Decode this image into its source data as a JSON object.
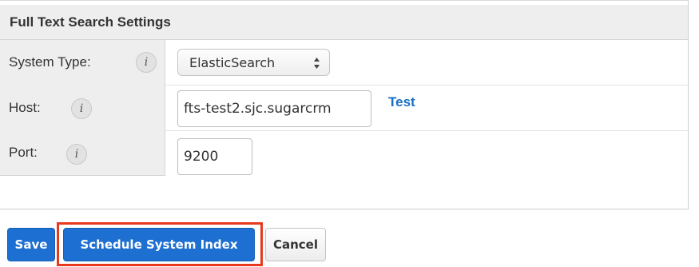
{
  "panel": {
    "title": "Full Text Search Settings"
  },
  "fields": {
    "system_type": {
      "label": "System Type:",
      "value": "ElasticSearch"
    },
    "host": {
      "label": "Host:",
      "value": "fts-test2.sjc.sugarcrm",
      "test_link": "Test"
    },
    "port": {
      "label": "Port:",
      "value": "9200"
    },
    "info_icon_glyph": "i"
  },
  "actions": {
    "save": "Save",
    "schedule": "Schedule System Index",
    "cancel": "Cancel"
  },
  "colors": {
    "primary_button": "#1d6fd1",
    "link": "#1b6fc2",
    "highlight": "#e8391e"
  },
  "icons": {
    "info": "info-circle-icon",
    "select_arrows": "up-down-arrows-icon"
  }
}
